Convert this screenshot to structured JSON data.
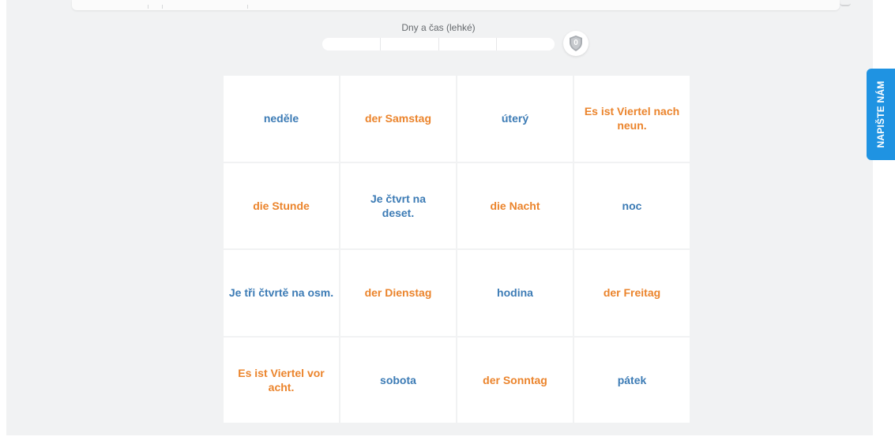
{
  "quiz": {
    "title": "Dny a čas (lehké)",
    "progress_segments": 4,
    "progress_filled": 0,
    "score": "0"
  },
  "cards": [
    {
      "text": "neděle",
      "lang": "cs"
    },
    {
      "text": "der Samstag",
      "lang": "de"
    },
    {
      "text": "úterý",
      "lang": "cs"
    },
    {
      "text": "Es ist Viertel nach neun.",
      "lang": "de"
    },
    {
      "text": "die Stunde",
      "lang": "de"
    },
    {
      "text": "Je čtvrt na deset.",
      "lang": "cs"
    },
    {
      "text": "die Nacht",
      "lang": "de"
    },
    {
      "text": "noc",
      "lang": "cs"
    },
    {
      "text": "Je tři čtvrtě na osm.",
      "lang": "cs"
    },
    {
      "text": "der Dienstag",
      "lang": "de"
    },
    {
      "text": "hodina",
      "lang": "cs"
    },
    {
      "text": "der Freitag",
      "lang": "de"
    },
    {
      "text": "Es ist Viertel vor acht.",
      "lang": "de"
    },
    {
      "text": "sobota",
      "lang": "cs"
    },
    {
      "text": "der Sonntag",
      "lang": "de"
    },
    {
      "text": "pátek",
      "lang": "cs"
    }
  ],
  "feedback_button": {
    "label": "NAPIŠTE NÁM"
  },
  "icons": {
    "score": "shield-icon"
  },
  "colors": {
    "czech_text": "#3c7bb5",
    "german_text": "#eb842c",
    "feedback_button": "#1f93e2",
    "background": "#f1f2f3"
  }
}
